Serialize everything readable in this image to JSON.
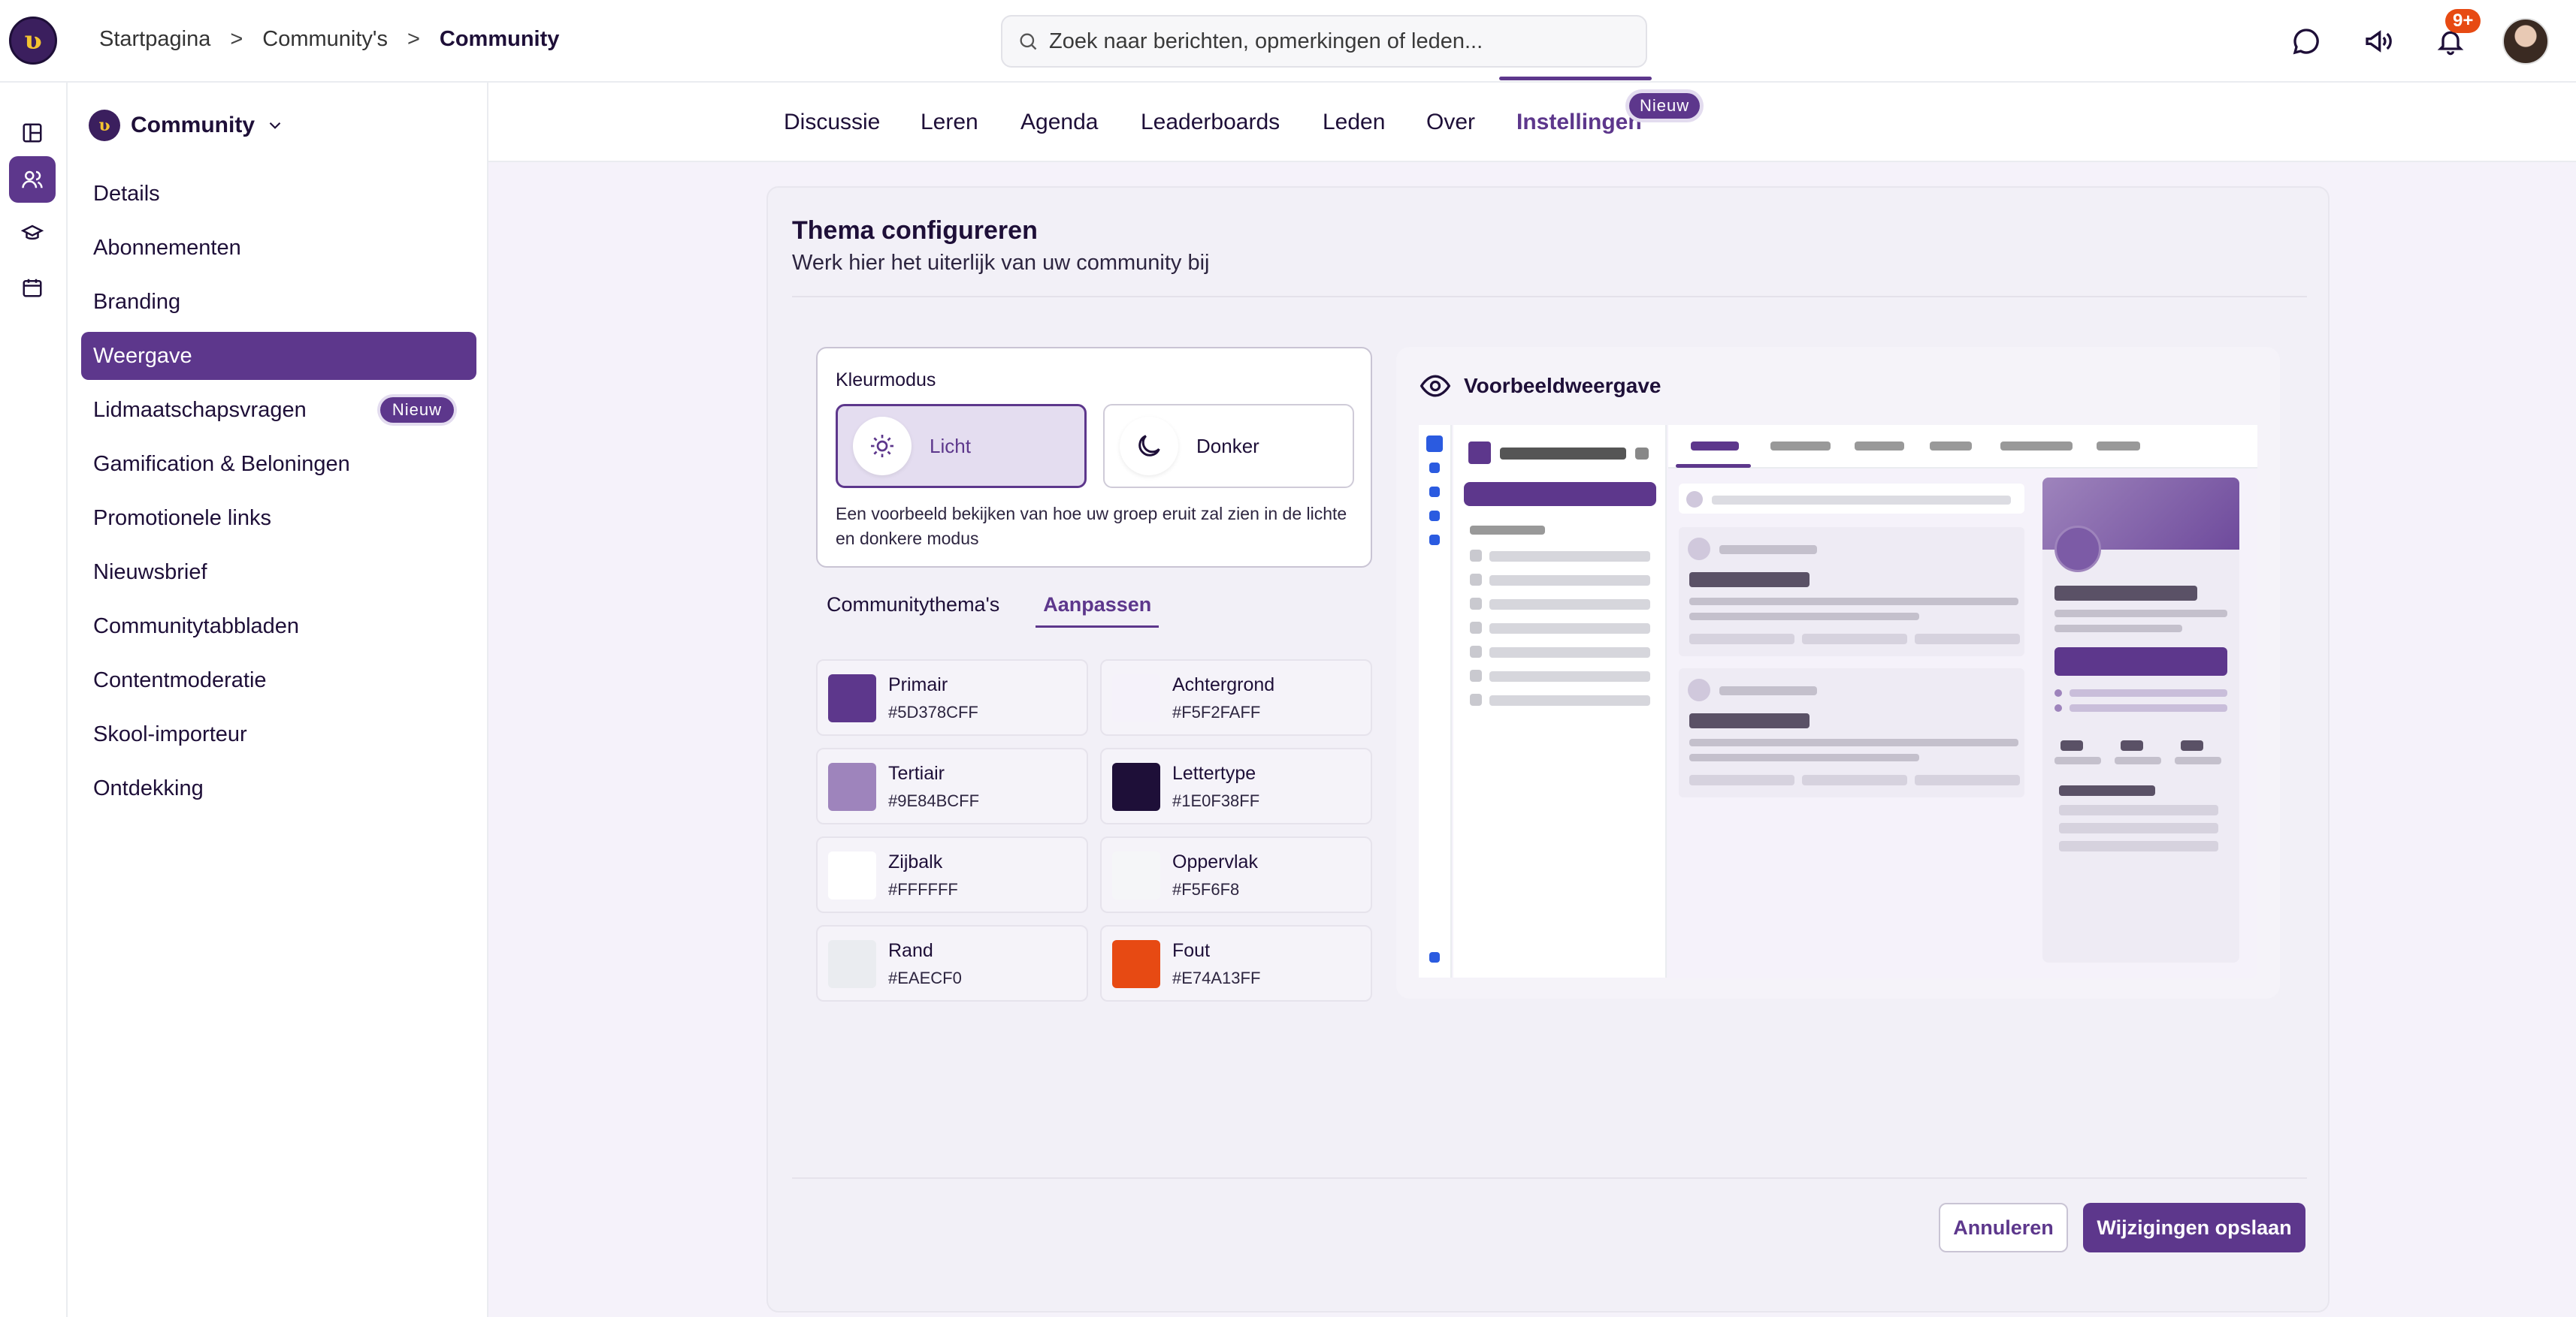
{
  "breadcrumb": {
    "home": "Startpagina",
    "sep1": ">",
    "parent": "Community's",
    "sep2": ">",
    "current": "Community"
  },
  "search": {
    "placeholder": "Zoek naar berichten, opmerkingen of leden..."
  },
  "header": {
    "notification_count": "9+"
  },
  "rail": {
    "icons": [
      "dashboard-icon",
      "users-icon",
      "graduation-cap-icon",
      "calendar-icon"
    ]
  },
  "sidebar": {
    "community": "Community",
    "items": [
      {
        "label": "Details"
      },
      {
        "label": "Abonnementen"
      },
      {
        "label": "Branding"
      },
      {
        "label": "Weergave",
        "active": true
      },
      {
        "label": "Lidmaatschapsvragen",
        "badge": "Nieuw"
      },
      {
        "label": "Gamification & Beloningen"
      },
      {
        "label": "Promotionele links"
      },
      {
        "label": "Nieuwsbrief"
      },
      {
        "label": "Communitytabbladen"
      },
      {
        "label": "Contentmoderatie"
      },
      {
        "label": "Skool-importeur"
      },
      {
        "label": "Ontdekking"
      }
    ]
  },
  "tabs": {
    "items": [
      "Discussie",
      "Leren",
      "Agenda",
      "Leaderboards",
      "Leden",
      "Over",
      "Instellingen"
    ],
    "active": "Instellingen",
    "badge": "Nieuw"
  },
  "theme": {
    "title": "Thema configureren",
    "subtitle": "Werk hier het uiterlijk van uw community bij",
    "mode": {
      "label": "Kleurmodus",
      "light": "Licht",
      "dark": "Donker",
      "selected": "Licht",
      "description": "Een voorbeeld bekijken van hoe uw groep eruit zal zien in de lichte en donkere modus"
    },
    "subtabs": {
      "themes": "Communitythema's",
      "customize": "Aanpassen",
      "active": "Aanpassen"
    },
    "colors": [
      {
        "name": "Primair",
        "hex": "#5D378CFF",
        "color": "#5D378C"
      },
      {
        "name": "Achtergrond",
        "hex": "#F5F2FAFF",
        "color": "#F5F2FA"
      },
      {
        "name": "Tertiair",
        "hex": "#9E84BCFF",
        "color": "#9E84BC"
      },
      {
        "name": "Lettertype",
        "hex": "#1E0F38FF",
        "color": "#1E0F38"
      },
      {
        "name": "Zijbalk",
        "hex": "#FFFFFF",
        "color": "#FFFFFF"
      },
      {
        "name": "Oppervlak",
        "hex": "#F5F6F8",
        "color": "#F5F6F8"
      },
      {
        "name": "Rand",
        "hex": "#EAECF0",
        "color": "#EAECF0"
      },
      {
        "name": "Fout",
        "hex": "#E74A13FF",
        "color": "#E74A13"
      }
    ],
    "preview": {
      "title": "Voorbeeldweergave"
    }
  },
  "footer": {
    "cancel": "Annuleren",
    "save": "Wijzigingen opslaan"
  }
}
